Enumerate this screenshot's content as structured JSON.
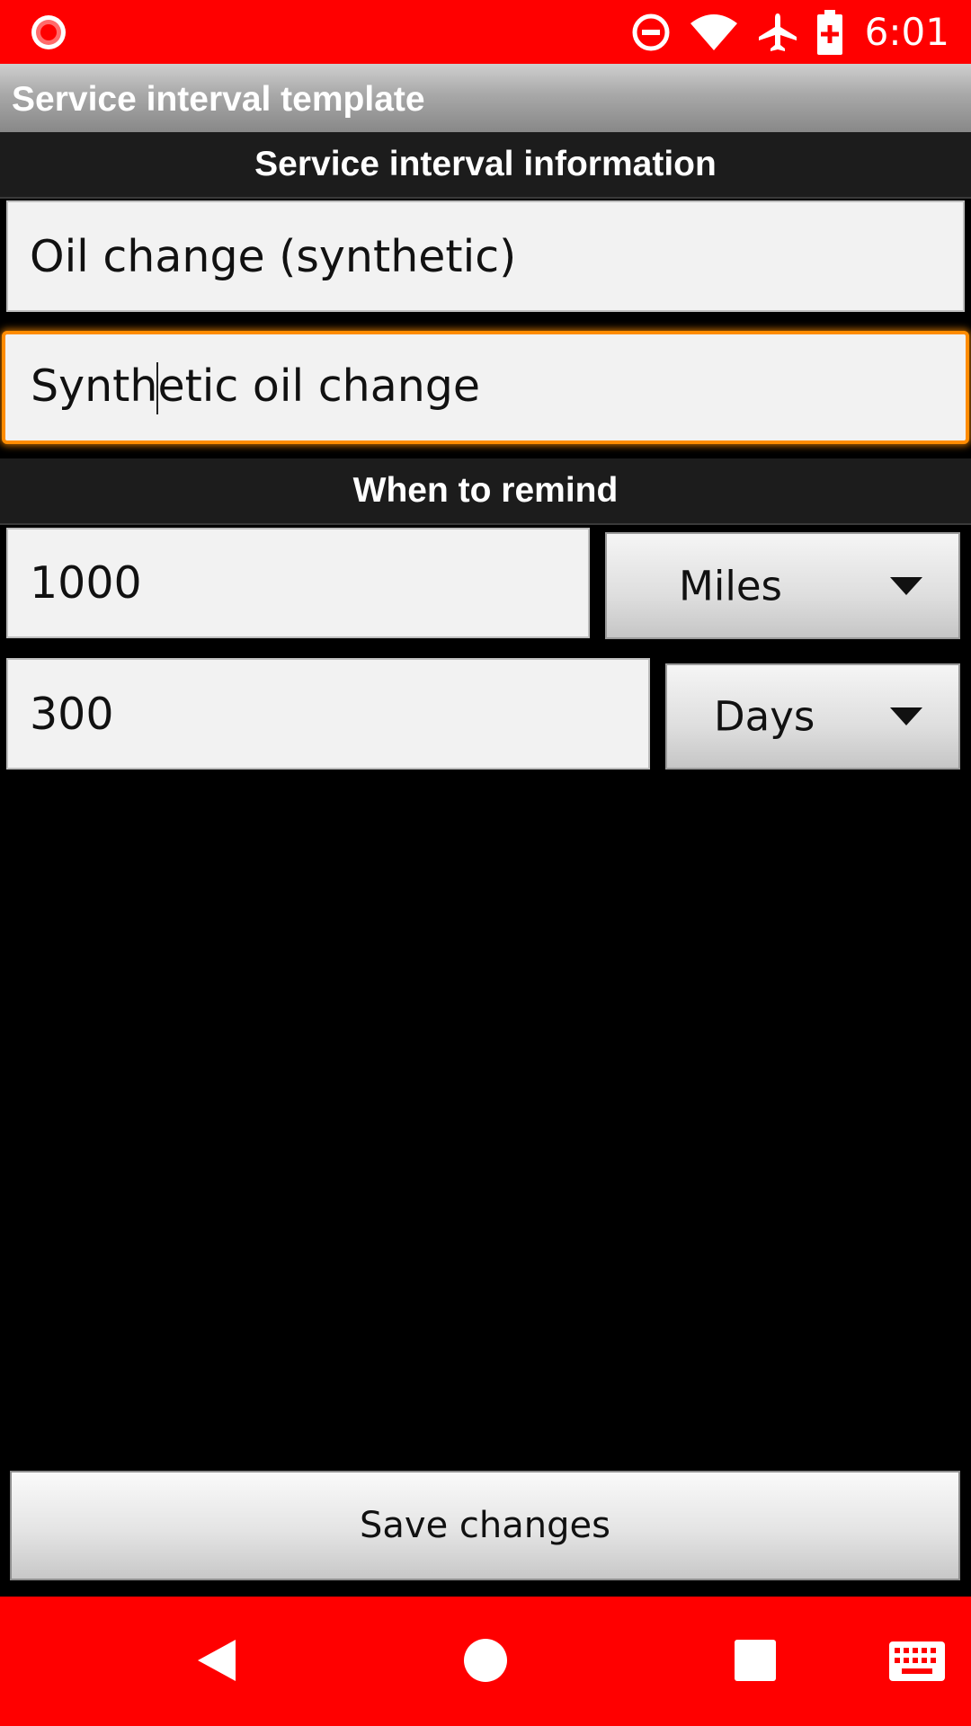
{
  "status_bar": {
    "time": "6:01",
    "icons": [
      "record-icon",
      "do-not-disturb-icon",
      "wifi-icon",
      "airplane-mode-icon",
      "battery-charging-icon"
    ]
  },
  "app_bar": {
    "title": "Service interval template"
  },
  "sections": {
    "info_header": "Service interval information",
    "remind_header": "When to remind"
  },
  "fields": {
    "name_value": "Oil change (synthetic)",
    "description_before_caret": "Synth",
    "description_after_caret": "etic oil change",
    "distance_value": "1000",
    "time_value": "300"
  },
  "spinners": {
    "distance_unit": "Miles",
    "time_unit": "Days"
  },
  "actions": {
    "save_label": "Save changes"
  },
  "nav_bar": {
    "icons": [
      "back-icon",
      "home-icon",
      "recents-icon",
      "keyboard-icon"
    ]
  },
  "colors": {
    "system_bars": "#ff0000",
    "focus_outline": "#ff8c00",
    "background": "#000000"
  }
}
